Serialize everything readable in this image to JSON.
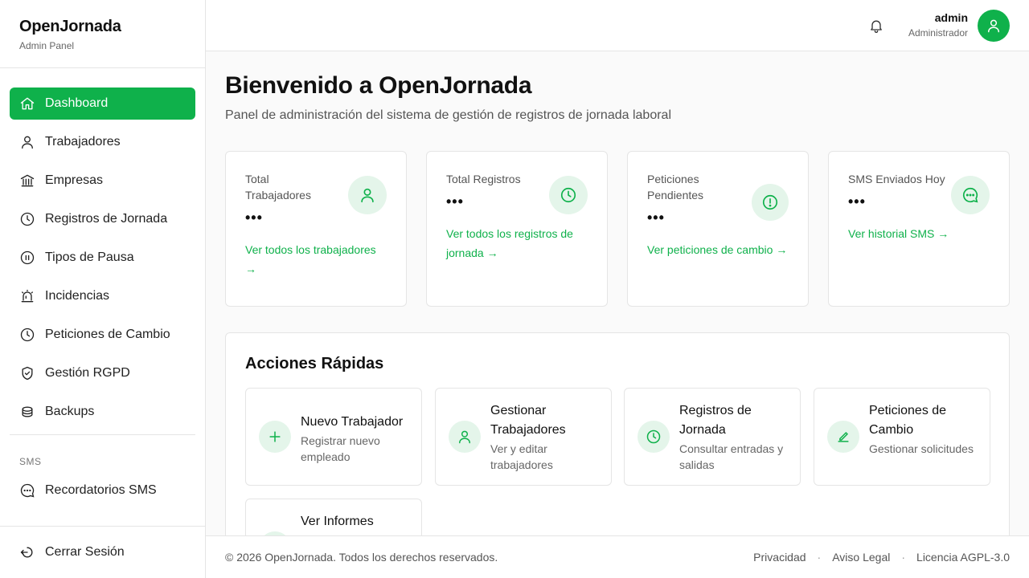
{
  "brand": {
    "title": "OpenJornada",
    "subtitle": "Admin Panel"
  },
  "sidebar": {
    "items": [
      {
        "label": "Dashboard",
        "icon": "home-icon",
        "active": true
      },
      {
        "label": "Trabajadores",
        "icon": "user-icon"
      },
      {
        "label": "Empresas",
        "icon": "bank-icon"
      },
      {
        "label": "Registros de Jornada",
        "icon": "clock-icon"
      },
      {
        "label": "Tipos de Pausa",
        "icon": "pause-icon"
      },
      {
        "label": "Incidencias",
        "icon": "alarm-icon"
      },
      {
        "label": "Peticiones de Cambio",
        "icon": "clock-icon"
      },
      {
        "label": "Gestión RGPD",
        "icon": "shield-check-icon"
      },
      {
        "label": "Backups",
        "icon": "database-icon"
      }
    ],
    "sms_section": "SMS",
    "sms_item": {
      "label": "Recordatorios SMS",
      "icon": "message-icon"
    },
    "logout": {
      "label": "Cerrar Sesión",
      "icon": "logout-icon"
    }
  },
  "topbar": {
    "user_name": "admin",
    "user_role": "Administrador"
  },
  "page": {
    "title": "Bienvenido a OpenJornada",
    "subtitle": "Panel de administración del sistema de gestión de registros de jornada laboral"
  },
  "stats": [
    {
      "label": "Total Trabajadores",
      "value": "•••",
      "link": "Ver todos los trabajadores →",
      "icon": "user-icon"
    },
    {
      "label": "Total Registros",
      "value": "•••",
      "link": "Ver todos los registros de jornada →",
      "icon": "clock-icon"
    },
    {
      "label": "Peticiones Pendientes",
      "value": "•••",
      "link": "Ver peticiones de cambio →",
      "icon": "alert-circle-icon"
    },
    {
      "label": "SMS Enviados Hoy",
      "value": "•••",
      "link": "Ver historial SMS →",
      "icon": "message-icon"
    }
  ],
  "quick_actions": {
    "title": "Acciones Rápidas",
    "items": [
      {
        "title": "Nuevo Trabajador",
        "desc": "Registrar nuevo empleado",
        "icon": "plus-icon"
      },
      {
        "title": "Gestionar Trabajadores",
        "desc": "Ver y editar trabajadores",
        "icon": "user-icon"
      },
      {
        "title": "Registros de Jornada",
        "desc": "Consultar entradas y salidas",
        "icon": "clock-icon"
      },
      {
        "title": "Peticiones de Cambio",
        "desc": "Gestionar solicitudes",
        "icon": "edit-icon"
      },
      {
        "title": "Ver Informes",
        "desc": "",
        "icon": "chart-icon"
      }
    ]
  },
  "footer": {
    "copyright": "© 2026 OpenJornada. Todos los derechos reservados.",
    "links": [
      "Privacidad",
      "Aviso Legal",
      "Licencia AGPL-3.0"
    ]
  },
  "colors": {
    "accent": "#0fb14b",
    "accent_soft": "#e4f5ea"
  }
}
